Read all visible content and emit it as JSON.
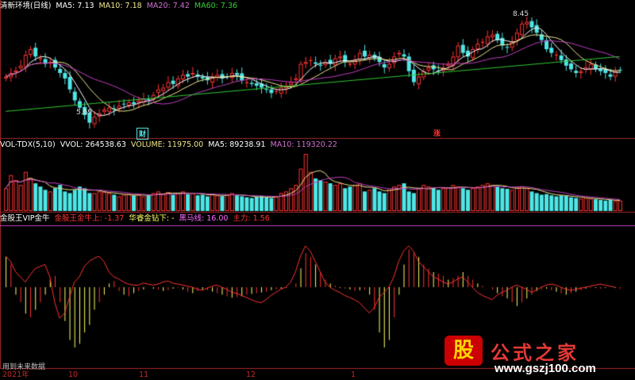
{
  "colors": {
    "background": "#000000",
    "up": "#ff3333",
    "down": "#4ee6e6",
    "ma5": "#ffffff",
    "ma10": "#f0e68c",
    "ma20": "#c03fc0",
    "ma60": "#33cc33",
    "divider": "#a52a2a"
  },
  "price_panel": {
    "title": "清新环境(日线)",
    "ma5": "MA5: 7.13",
    "ma10": "MA10: 7.18",
    "ma20": "MA20: 7.42",
    "ma60": "MA60: 7.36",
    "max_label": "8.45",
    "min_label": "5.69",
    "tag_cai": "财",
    "tag_zhang": "涨"
  },
  "volume_panel": {
    "title": "VOL-TDX(5,10)",
    "vvol": "VVOL: 264538.63",
    "volume": "VOLUME: 11975.00",
    "ma5": "MA5: 89238.91",
    "ma10": "MA10: 119320.22"
  },
  "indicator_panel": {
    "title": "金股王VIP金牛",
    "item1": "金股王金牛上: -1.37",
    "item2": "华睿金钻下: -",
    "item3": "黑马线: 16.00",
    "item4": "主力: 1.56"
  },
  "footer": {
    "note": "用到未来数据",
    "months": [
      "2021年",
      "10",
      "11",
      "12",
      "1"
    ]
  },
  "watermark": {
    "mark": "股",
    "text": "公式之家",
    "url": "www.gszj100.com"
  },
  "series": {
    "close": [
      6.95,
      7.05,
      7.12,
      7.25,
      7.55,
      7.7,
      7.5,
      7.45,
      7.3,
      7.35,
      7.2,
      7.05,
      6.9,
      6.6,
      6.3,
      6.1,
      5.9,
      5.69,
      5.85,
      5.95,
      6.05,
      6.1,
      6.05,
      6.15,
      6.2,
      6.25,
      6.2,
      6.3,
      6.35,
      6.3,
      6.45,
      6.6,
      6.65,
      6.8,
      6.75,
      6.9,
      7.0,
      6.95,
      7.05,
      6.95,
      6.9,
      6.85,
      6.95,
      7.0,
      6.9,
      6.95,
      7.05,
      7.0,
      6.85,
      6.8,
      6.75,
      6.7,
      6.65,
      6.6,
      6.5,
      6.55,
      6.65,
      6.7,
      6.8,
      6.9,
      7.3,
      7.35,
      7.4,
      7.3,
      7.25,
      7.35,
      7.3,
      7.45,
      7.5,
      7.35,
      7.3,
      7.4,
      7.6,
      7.5,
      7.55,
      7.45,
      7.35,
      7.2,
      7.3,
      7.5,
      7.6,
      7.5,
      7.1,
      6.8,
      6.95,
      7.1,
      7.2,
      7.15,
      7.1,
      7.2,
      7.3,
      7.5,
      7.8,
      7.6,
      7.5,
      7.7,
      7.85,
      7.9,
      8.05,
      8.1,
      7.95,
      7.8,
      7.75,
      7.9,
      8.15,
      8.4,
      8.45,
      8.3,
      8.15,
      7.95,
      7.7,
      7.6,
      7.55,
      7.4,
      7.25,
      7.15,
      7.05,
      7.1,
      7.2,
      7.3,
      7.15,
      7.1,
      7.05,
      6.95,
      7.1,
      7.13
    ],
    "volume": [
      70,
      110,
      95,
      80,
      120,
      100,
      85,
      75,
      65,
      60,
      70,
      80,
      60,
      55,
      65,
      75,
      70,
      55,
      55,
      60,
      58,
      55,
      50,
      45,
      50,
      52,
      48,
      50,
      45,
      48,
      55,
      60,
      52,
      58,
      50,
      55,
      60,
      52,
      55,
      48,
      50,
      45,
      52,
      48,
      46,
      50,
      55,
      48,
      45,
      42,
      40,
      44,
      46,
      42,
      40,
      45,
      55,
      60,
      70,
      80,
      130,
      175,
      120,
      100,
      95,
      90,
      85,
      80,
      85,
      70,
      75,
      80,
      85,
      60,
      65,
      70,
      60,
      55,
      65,
      75,
      80,
      85,
      60,
      55,
      70,
      80,
      75,
      70,
      65,
      70,
      72,
      80,
      75,
      70,
      65,
      70,
      75,
      80,
      85,
      80,
      75,
      70,
      68,
      65,
      72,
      76,
      70,
      60,
      55,
      50,
      52,
      48,
      45,
      48,
      46,
      42,
      40,
      38,
      40,
      38,
      36,
      34,
      32,
      34,
      30,
      32
    ],
    "indicator": [
      40,
      30,
      -10,
      -20,
      -35,
      -40,
      -30,
      -20,
      -10,
      10,
      15,
      -20,
      -45,
      -70,
      -80,
      -75,
      -60,
      -50,
      -30,
      -20,
      -10,
      5,
      8,
      -5,
      -10,
      -12,
      -8,
      -5,
      -3,
      0,
      -2,
      -3,
      -5,
      -4,
      -2,
      -1,
      -3,
      -6,
      -8,
      -5,
      -3,
      -4,
      -6,
      -8,
      -10,
      -12,
      -14,
      -13,
      -12,
      -10,
      -9,
      -8,
      -7,
      -6,
      -4,
      -3,
      -2,
      -1,
      0,
      5,
      25,
      45,
      40,
      30,
      20,
      10,
      5,
      2,
      -1,
      -2,
      -3,
      -5,
      -4,
      -3,
      -10,
      -30,
      -60,
      -80,
      -70,
      -40,
      -10,
      30,
      50,
      45,
      40,
      30,
      25,
      20,
      18,
      15,
      10,
      12,
      15,
      20,
      15,
      10,
      5,
      2,
      0,
      -3,
      -8,
      -12,
      -15,
      -20,
      -25,
      -20,
      -15,
      -10,
      -5,
      -3,
      -2,
      -4,
      -6,
      -8,
      -10,
      -8,
      -6,
      -4,
      -2,
      -1,
      -1,
      -2,
      -1,
      0,
      -1,
      -2
    ],
    "main_line": [
      30,
      25,
      15,
      10,
      5,
      12,
      18,
      20,
      22,
      10,
      -15,
      -30,
      -25,
      -10,
      5,
      10,
      20,
      25,
      28,
      30,
      25,
      15,
      10,
      8,
      5,
      3,
      2,
      2,
      4,
      3,
      2,
      3,
      5,
      6,
      4,
      3,
      2,
      1,
      0,
      -2,
      -3,
      -1,
      1,
      2,
      0,
      -2,
      -5,
      -6,
      -8,
      -10,
      -12,
      -14,
      -15,
      -12,
      -8,
      -5,
      -2,
      0,
      5,
      15,
      30,
      40,
      35,
      25,
      15,
      5,
      0,
      -3,
      -5,
      -8,
      -10,
      -12,
      -15,
      -20,
      -25,
      -20,
      -10,
      -5,
      0,
      10,
      25,
      35,
      40,
      35,
      25,
      20,
      15,
      10,
      8,
      5,
      3,
      5,
      8,
      10,
      5,
      0,
      -5,
      -8,
      -10,
      -12,
      -8,
      -5,
      -3,
      0,
      2,
      0,
      -2,
      -5,
      -3,
      0,
      2,
      3,
      2,
      0,
      -2,
      -3,
      -2,
      -1,
      0,
      1,
      2,
      3,
      2,
      1,
      0
    ]
  }
}
